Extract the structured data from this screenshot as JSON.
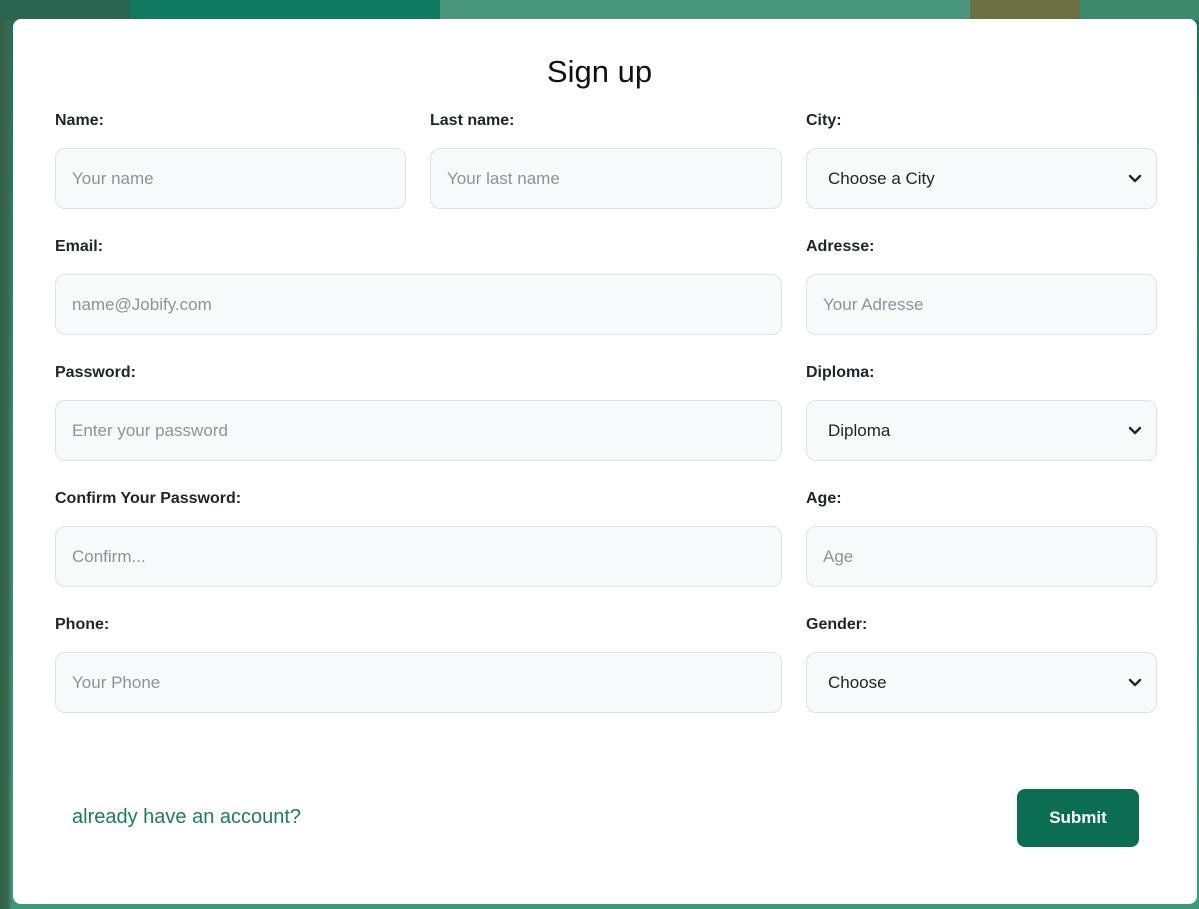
{
  "form": {
    "title": "Sign up",
    "fields": {
      "name": {
        "label": "Name:",
        "placeholder": "Your name"
      },
      "last_name": {
        "label": "Last name:",
        "placeholder": "Your last name"
      },
      "city": {
        "label": "City:",
        "value": "Choose a City"
      },
      "email": {
        "label": "Email:",
        "placeholder": "name@Jobify.com"
      },
      "address": {
        "label": "Adresse:",
        "placeholder": "Your Adresse"
      },
      "password": {
        "label": "Password:",
        "placeholder": "Enter your password"
      },
      "diploma": {
        "label": "Diploma:",
        "value": "Diploma"
      },
      "confirm_password": {
        "label": "Confirm Your Password:",
        "placeholder": "Confirm..."
      },
      "age": {
        "label": "Age:",
        "placeholder": "Age"
      },
      "phone": {
        "label": "Phone:",
        "placeholder": "Your Phone"
      },
      "gender": {
        "label": "Gender:",
        "value": "Choose"
      }
    },
    "login_link": "already have an account?",
    "submit_label": "Submit"
  },
  "colors": {
    "accent": "#0b6e52",
    "link": "#1e7a5e",
    "field_bg": "#f8f9fa",
    "field_border": "#dee2e6"
  }
}
